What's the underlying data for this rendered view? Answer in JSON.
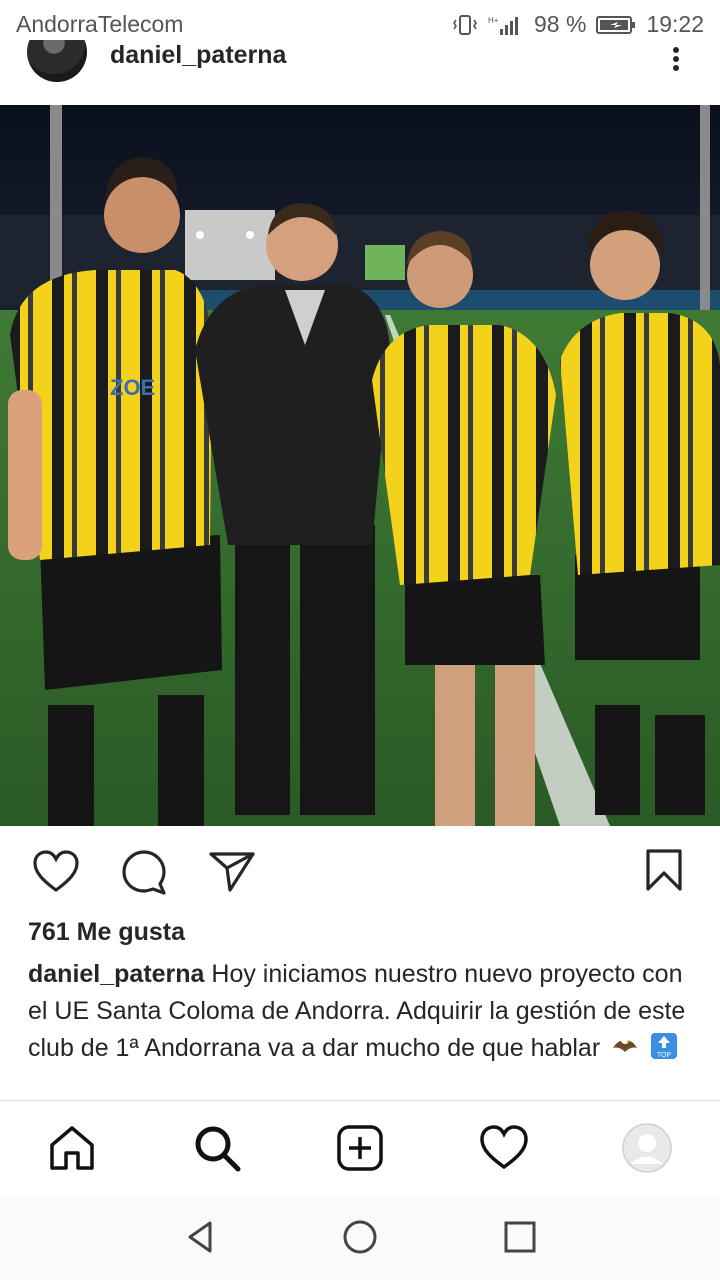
{
  "status_bar": {
    "carrier": "AndorraTelecom",
    "battery_percent": "98 %",
    "time": "19:22",
    "icons": [
      "vibrate-icon",
      "signal-icon",
      "battery-icon"
    ]
  },
  "post": {
    "username": "daniel_paterna",
    "likes_text": "761 Me gusta",
    "caption_user": "daniel_paterna",
    "caption_text": "Hoy iniciamos nuestro nuevo proyecto con el UE Santa Coloma de Andorra. Adquirir la gestión de este club de 1ª Andorrana va a dar mucho de que hablar",
    "caption_emojis": [
      "eagle-emoji",
      "top-arrow-emoji"
    ],
    "photo": {
      "description_icon": "photo-image",
      "sponsor_text": "ZOE"
    }
  },
  "actions": [
    "like-icon",
    "comment-icon",
    "share-icon",
    "save-icon"
  ],
  "tab_bar": [
    "home-icon",
    "search-icon",
    "new-post-icon",
    "activity-icon",
    "profile-icon"
  ],
  "nav_bar": [
    "back-icon",
    "home-nav-icon",
    "recents-icon"
  ],
  "colors": {
    "text": "#262626",
    "jersey_yellow": "#f2d21a",
    "jersey_black": "#151515",
    "pitch_green": "#2f6a2f"
  }
}
